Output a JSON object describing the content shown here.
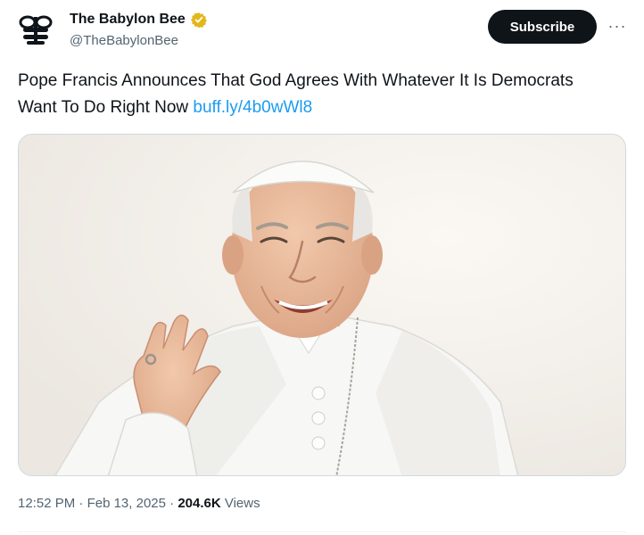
{
  "author": {
    "name": "The Babylon Bee",
    "handle": "@TheBabylonBee",
    "verified_color": "#e2b719",
    "avatar_icon": "bee-logo-icon"
  },
  "actions": {
    "subscribe_label": "Subscribe",
    "more_label": "···"
  },
  "tweet": {
    "text": "Pope Francis Announces That God Agrees With Whatever It Is Democrats Want To Do Right Now",
    "link": "buff.ly/4b0wWl8"
  },
  "meta": {
    "time": "12:52 PM",
    "separator": " · ",
    "date": "Feb 13, 2025",
    "views_count": "204.6K",
    "views_label": "Views"
  },
  "colors": {
    "link": "#1d9bf0",
    "text": "#0f1419",
    "secondary": "#536471",
    "button_bg": "#0f1419"
  }
}
